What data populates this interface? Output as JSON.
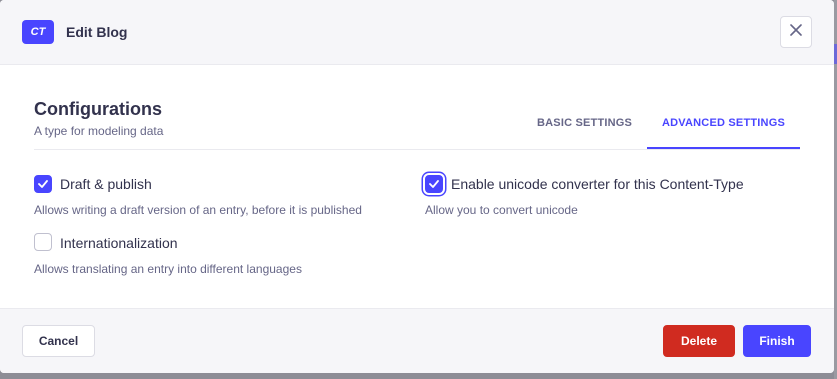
{
  "header": {
    "badge": "CT",
    "title": "Edit Blog",
    "close_icon": "close-icon"
  },
  "section": {
    "title": "Configurations",
    "subtitle": "A type for modeling data"
  },
  "tabs": [
    {
      "label": "BASIC SETTINGS",
      "active": false
    },
    {
      "label": "ADVANCED SETTINGS",
      "active": true
    }
  ],
  "options": {
    "draft_publish": {
      "label": "Draft & publish",
      "hint": "Allows writing a draft version of an entry, before it is published",
      "checked": true
    },
    "i18n": {
      "label": "Internationalization",
      "hint": "Allows translating an entry into different languages",
      "checked": false
    },
    "unicode": {
      "label": "Enable unicode converter for this Content-Type",
      "hint": "Allow you to convert unicode",
      "checked": true
    }
  },
  "footer": {
    "cancel_label": "Cancel",
    "delete_label": "Delete",
    "finish_label": "Finish"
  },
  "colors": {
    "primary": "#4945ff",
    "danger": "#d02b20",
    "header_bg": "#f6f6f9"
  }
}
